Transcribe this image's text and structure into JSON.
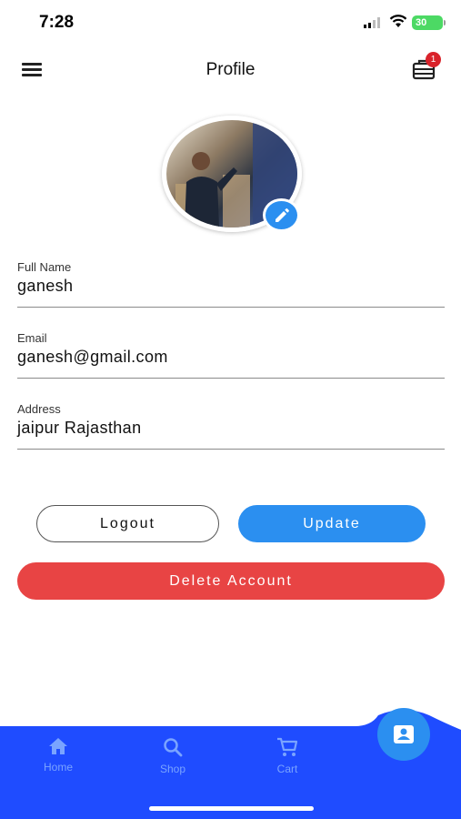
{
  "status_bar": {
    "time": "7:28",
    "battery": "30"
  },
  "header": {
    "title": "Profile",
    "cart_badge": "1"
  },
  "form": {
    "full_name": {
      "label": "Full Name",
      "value": "ganesh"
    },
    "email": {
      "label": "Email",
      "value": "ganesh@gmail.com"
    },
    "address": {
      "label": "Address",
      "value": "jaipur Rajasthan"
    }
  },
  "buttons": {
    "logout": "Logout",
    "update": "Update",
    "delete": "Delete Account"
  },
  "bottom_nav": {
    "items": [
      {
        "label": "Home",
        "icon": "home-icon"
      },
      {
        "label": "Shop",
        "icon": "search-icon"
      },
      {
        "label": "Cart",
        "icon": "cart-icon"
      }
    ],
    "active_icon": "profile-icon"
  },
  "colors": {
    "primary": "#2b8ff0",
    "danger": "#e84444",
    "nav_background": "#1f4cff",
    "badge": "#d9232b"
  }
}
